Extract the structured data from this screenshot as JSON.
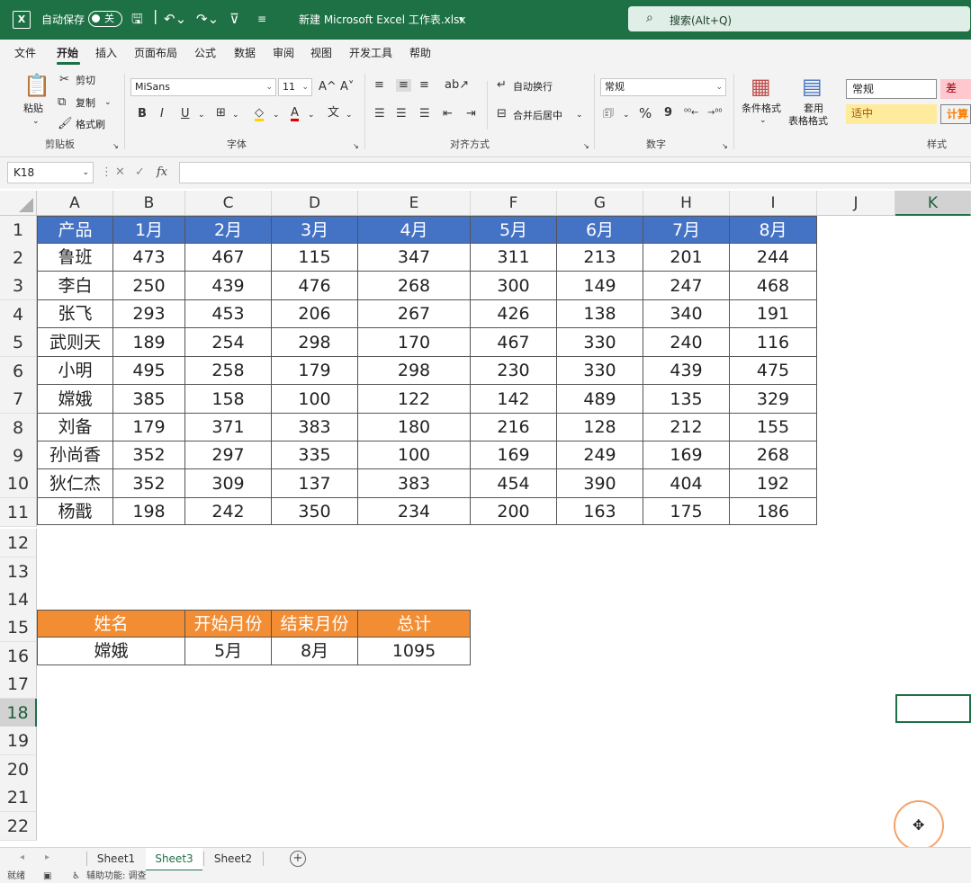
{
  "title_bar": {
    "app_icon_letter": "X",
    "autosave_label": "自动保存",
    "autosave_state": "关",
    "save_icon": "save-icon",
    "undo_icon": "undo-icon",
    "redo_icon": "redo-icon",
    "filter_icon": "filter-icon",
    "file_name": "新建 Microsoft Excel 工作表.xlsx",
    "search_placeholder": "搜索(Alt+Q)"
  },
  "menu": {
    "tabs": [
      "文件",
      "开始",
      "插入",
      "页面布局",
      "公式",
      "数据",
      "审阅",
      "视图",
      "开发工具",
      "帮助"
    ],
    "active": "开始"
  },
  "ribbon": {
    "clipboard": {
      "paste": "粘贴",
      "cut": "剪切",
      "copy": "复制",
      "format_painter": "格式刷",
      "group": "剪贴板"
    },
    "font": {
      "name": "MiSans",
      "size": "11",
      "bold": "B",
      "italic": "I",
      "underline": "U",
      "grow": "A^",
      "shrink": "A˅",
      "font_color": "A",
      "phonetic": "文",
      "group": "字体"
    },
    "alignment": {
      "wrap_text": "自动换行",
      "merge_center": "合并后居中",
      "group": "对齐方式"
    },
    "number": {
      "format": "常规",
      "percent": "%",
      "comma": "9",
      "group": "数字"
    },
    "styles": {
      "conditional_format": "条件格式",
      "format_as_table_1": "套用",
      "format_as_table_2": "表格格式",
      "normal": "常规",
      "bad": "差",
      "neutral": "适中",
      "calculation": "计算",
      "group": "样式"
    }
  },
  "formula_bar": {
    "name_box": "K18",
    "fx": "fx",
    "content": ""
  },
  "columns": [
    "A",
    "B",
    "C",
    "D",
    "E",
    "F",
    "G",
    "H",
    "I",
    "J",
    "K"
  ],
  "selected_column": "K",
  "rows": [
    "1",
    "2",
    "3",
    "4",
    "5",
    "6",
    "7",
    "8",
    "9",
    "10",
    "11",
    "12",
    "13",
    "14",
    "15",
    "16",
    "17",
    "18",
    "19",
    "20",
    "21",
    "22"
  ],
  "selected_row": "18",
  "table1": {
    "header": [
      "产品",
      "1月",
      "2月",
      "3月",
      "4月",
      "5月",
      "6月",
      "7月",
      "8月"
    ],
    "rows": [
      [
        "鲁班",
        "473",
        "467",
        "115",
        "347",
        "311",
        "213",
        "201",
        "244"
      ],
      [
        "李白",
        "250",
        "439",
        "476",
        "268",
        "300",
        "149",
        "247",
        "468"
      ],
      [
        "张飞",
        "293",
        "453",
        "206",
        "267",
        "426",
        "138",
        "340",
        "191"
      ],
      [
        "武则天",
        "189",
        "254",
        "298",
        "170",
        "467",
        "330",
        "240",
        "116"
      ],
      [
        "小明",
        "495",
        "258",
        "179",
        "298",
        "230",
        "330",
        "439",
        "475"
      ],
      [
        "嫦娥",
        "385",
        "158",
        "100",
        "122",
        "142",
        "489",
        "135",
        "329"
      ],
      [
        "刘备",
        "179",
        "371",
        "383",
        "180",
        "216",
        "128",
        "212",
        "155"
      ],
      [
        "孙尚香",
        "352",
        "297",
        "335",
        "100",
        "169",
        "249",
        "169",
        "268"
      ],
      [
        "狄仁杰",
        "352",
        "309",
        "137",
        "383",
        "454",
        "390",
        "404",
        "192"
      ],
      [
        "杨戬",
        "198",
        "242",
        "350",
        "234",
        "200",
        "163",
        "175",
        "186"
      ]
    ]
  },
  "table2": {
    "header": [
      "姓名",
      "开始月份",
      "结束月份",
      "总计"
    ],
    "row": [
      "嫦娥",
      "5月",
      "8月",
      "1095"
    ]
  },
  "sheet_tabs": [
    "Sheet1",
    "Sheet3",
    "Sheet2"
  ],
  "active_sheet": "Sheet3",
  "add_sheet": "+",
  "status": {
    "ready": "就绪",
    "accessibility": "辅助功能: 调查"
  },
  "colors": {
    "title_green": "#1e7145",
    "header_blue": "#4472c4",
    "header_orange": "#f28d33"
  }
}
